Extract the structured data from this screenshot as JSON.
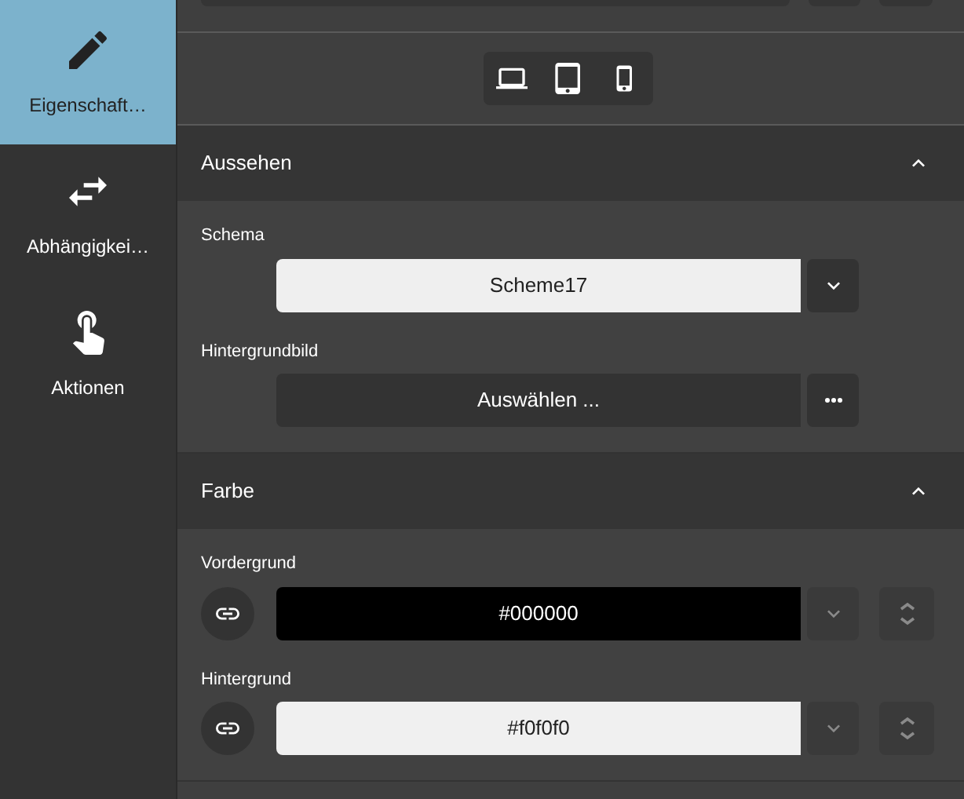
{
  "sidebar": {
    "items": [
      {
        "kind": "pencil",
        "label": "Eigenschaft…",
        "selected": true
      },
      {
        "kind": "swap",
        "label": "Abhängigkei…",
        "selected": false
      },
      {
        "kind": "touch",
        "label": "Aktionen",
        "selected": false
      }
    ]
  },
  "device_toggles": [
    {
      "kind": "laptop"
    },
    {
      "kind": "tablet"
    },
    {
      "kind": "phone"
    }
  ],
  "sections": [
    {
      "title": "Aussehen",
      "expanded": true,
      "rows": [
        {
          "kind": "select",
          "label": "Schema",
          "value": "Scheme17"
        },
        {
          "kind": "picker",
          "label": "Hintergrundbild",
          "value": "Auswählen ..."
        }
      ]
    },
    {
      "title": "Farbe",
      "expanded": true,
      "rows": [
        {
          "kind": "color",
          "label": "Vordergrund",
          "value": "#000000",
          "dark": true
        },
        {
          "kind": "color",
          "label": "Hintergrund",
          "value": "#f0f0f0",
          "dark": false
        }
      ]
    }
  ]
}
